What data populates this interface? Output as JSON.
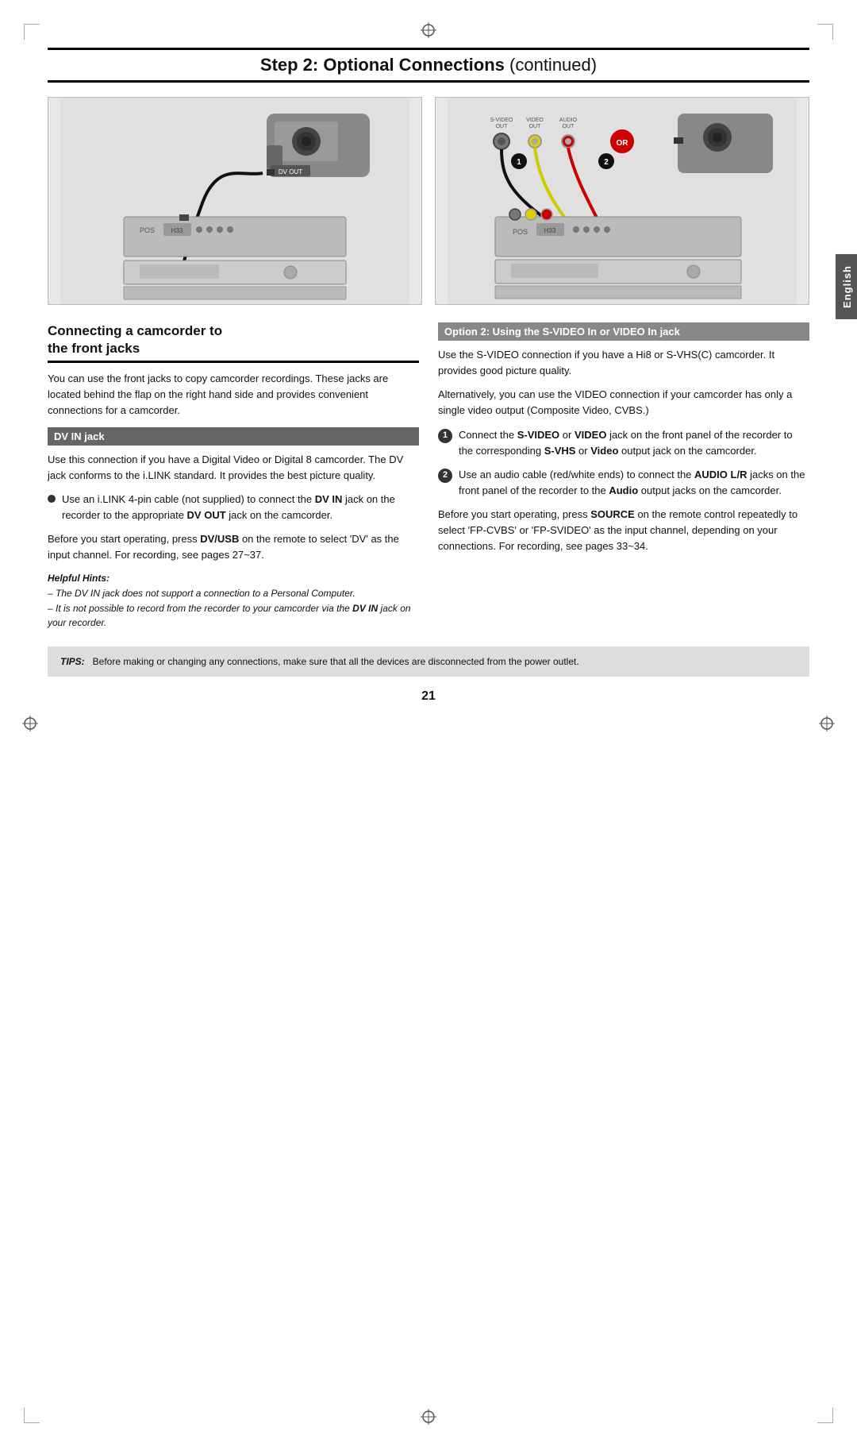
{
  "page": {
    "title_bold": "Step 2: Optional Connections",
    "title_normal": " (continued)",
    "page_number": "21",
    "english_tab": "English"
  },
  "left_column": {
    "heading_line1": "Connecting a camcorder to",
    "heading_line2": "the front jacks",
    "intro": "You can use the front jacks to copy camcorder recordings. These jacks are located behind the flap on the right hand side and provides convenient connections for a camcorder.",
    "dv_in_bar": "DV IN jack",
    "dv_in_body": "Use this connection if you have a Digital Video or Digital 8 camcorder. The DV jack conforms to the i.LINK standard. It provides the best picture quality.",
    "bullet_text": "Use an i.LINK 4-pin cable (not supplied) to connect the DV IN jack on the recorder to the appropriate DV OUT jack on the camcorder.",
    "before_text": "Before you start operating, press DV/USB on the remote to select 'DV' as the input channel. For recording, see pages 27~37.",
    "helpful_hints_title": "Helpful Hints:",
    "hint1": "– The DV IN jack does not support a connection to a Personal Computer.",
    "hint2": "– It is not possible to record from the recorder to your camcorder via the DV IN jack on your recorder."
  },
  "right_column": {
    "option2_bar": "Option 2: Using the S-VIDEO In or VIDEO In jack",
    "svideo_body1": "Use the S-VIDEO connection if you have a Hi8 or S-VHS(C) camcorder. It provides good picture quality.",
    "svideo_body2": "Alternatively, you can use the VIDEO connection if your camcorder has only a single video output (Composite Video, CVBS.)",
    "step1_text": "Connect the S-VIDEO or VIDEO jack on the front panel of the recorder to the corresponding S-VHS or Video output jack on the camcorder.",
    "step2_text": "Use an audio cable (red/white ends) to connect the AUDIO L/R jacks on the front panel of the recorder to the Audio output jacks on the camcorder.",
    "before_text2": "Before you start operating, press SOURCE on the remote control repeatedly to select 'FP-CVBS' or 'FP-SVIDEO' as the input channel, depending on your connections. For recording, see pages 33~34."
  },
  "tips": {
    "label": "TIPS:",
    "text": "Before making or changing any connections, make sure that all the devices are disconnected from the power outlet."
  }
}
